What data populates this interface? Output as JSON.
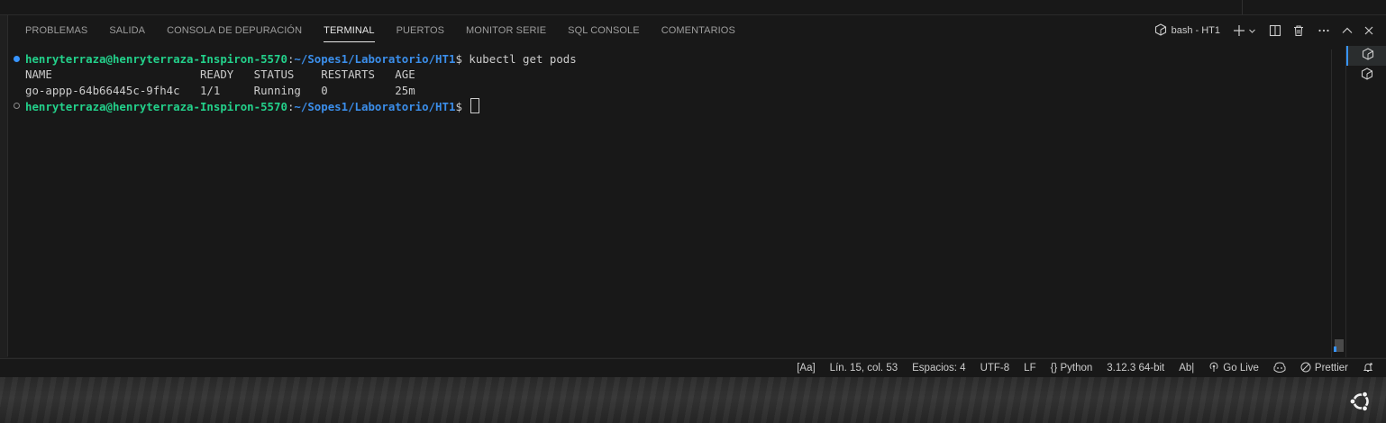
{
  "panel": {
    "tabs": [
      {
        "label": "PROBLEMAS"
      },
      {
        "label": "SALIDA"
      },
      {
        "label": "CONSOLA DE DEPURACIÓN"
      },
      {
        "label": "TERMINAL",
        "active": true
      },
      {
        "label": "PUERTOS"
      },
      {
        "label": "MONITOR SERIE"
      },
      {
        "label": "SQL CONSOLE"
      },
      {
        "label": "COMENTARIOS"
      }
    ],
    "terminal_instance": "bash - HT1"
  },
  "terminal": {
    "prompt_user": "henryterraza@henryterraza-Inspiron-5570",
    "prompt_sep": ":",
    "prompt_path": "~/Sopes1/Laboratorio/HT1",
    "prompt_symbol": "$ ",
    "command": "kubectl get pods",
    "header": "NAME                      READY   STATUS    RESTARTS   AGE",
    "row": "go-appp-64b66445c-9fh4c   1/1     Running   0          25m"
  },
  "statusbar": {
    "items": [
      {
        "label": "[Aa]"
      },
      {
        "label": "Lín. 15, col. 53"
      },
      {
        "label": "Espacios: 4"
      },
      {
        "label": "UTF-8"
      },
      {
        "label": "LF"
      },
      {
        "label": "{} Python"
      },
      {
        "label": "3.12.3 64-bit"
      },
      {
        "label": "Ab|"
      },
      {
        "label": "Go Live",
        "icon": "broadcast-icon"
      },
      {
        "label": "",
        "icon": "copilot-icon"
      },
      {
        "label": "Prettier",
        "icon": "prettier-disabled-icon"
      },
      {
        "label": "",
        "icon": "bell-icon"
      }
    ]
  },
  "colors": {
    "panel_bg": "#181818",
    "prompt_user": "#23d18b",
    "prompt_path": "#3b8eea",
    "accent": "#3794ff"
  }
}
